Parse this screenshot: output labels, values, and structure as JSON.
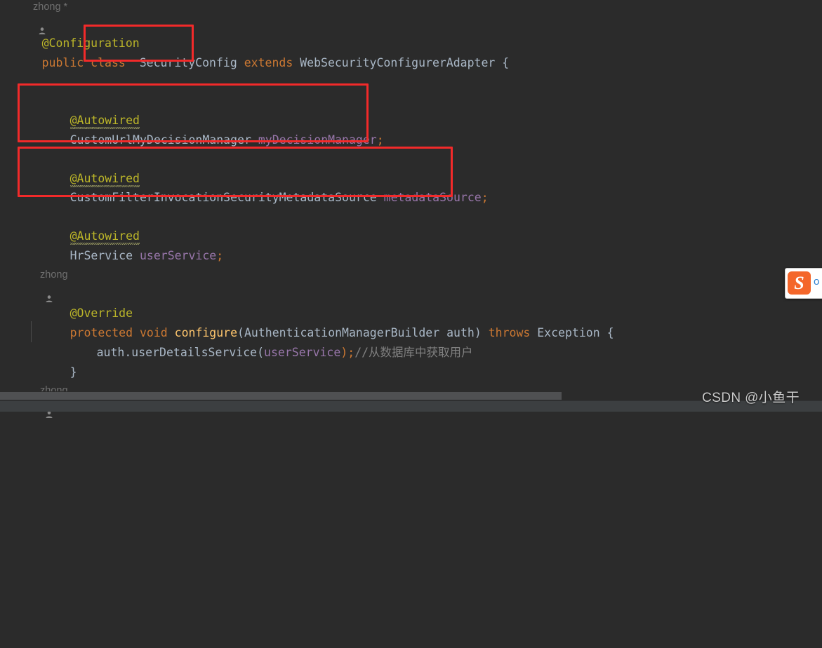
{
  "editor": {
    "background_color": "#2b2b2b",
    "default_text_color": "#a9b7c6",
    "annotation_box_color": "#f22a2a"
  },
  "vcs_annotations": [
    {
      "author": "zhong",
      "modified_marker": "*"
    },
    {
      "author": "zhong",
      "modified_marker": ""
    },
    {
      "author": "zhong",
      "modified_marker": ""
    }
  ],
  "code": {
    "line1": {
      "annotation": "@Configuration"
    },
    "line2": {
      "kw_public": "public",
      "kw_class": "class",
      "class_name": "SecurityConfig",
      "kw_extends": "extends",
      "super_class": "WebSecurityConfigurerAdapter",
      "brace": "{"
    },
    "field1": {
      "annotation": "@Autowired",
      "type": "CustomUrlMyDecisionManager",
      "name": "myDecisionManager",
      "semicolon": ";"
    },
    "field2": {
      "annotation": "@Autowired",
      "type": "CustomFilterInvocationSecurityMetadataSource",
      "name": "metadataSource",
      "semicolon": ";"
    },
    "field3": {
      "annotation": "@Autowired",
      "type": "HrService",
      "name": "userService",
      "semicolon": ";"
    },
    "method": {
      "annotation": "@Override",
      "modifier": "protected",
      "return_type": "void",
      "name": "configure",
      "open_paren": "(",
      "param_type": "AuthenticationManagerBuilder",
      "param_name": "auth",
      "close_paren": ")",
      "kw_throws": "throws",
      "exception": "Exception",
      "open_brace": "{",
      "body_call_prefix": "auth.userDetailsService",
      "body_arg": "userService",
      "body_suffix": ");",
      "body_comment": "//从数据库中获取用户",
      "close_brace": "}"
    }
  },
  "highlight_boxes": [
    {
      "label": "class-name-box"
    },
    {
      "label": "field-my-decision-manager-box"
    },
    {
      "label": "field-metadata-source-box"
    }
  ],
  "ime": {
    "logo_letter": "S",
    "logo_tail": "o"
  },
  "watermark": {
    "text": "CSDN @小鱼干　　"
  },
  "scrollbar": {
    "orientation": "horizontal"
  }
}
